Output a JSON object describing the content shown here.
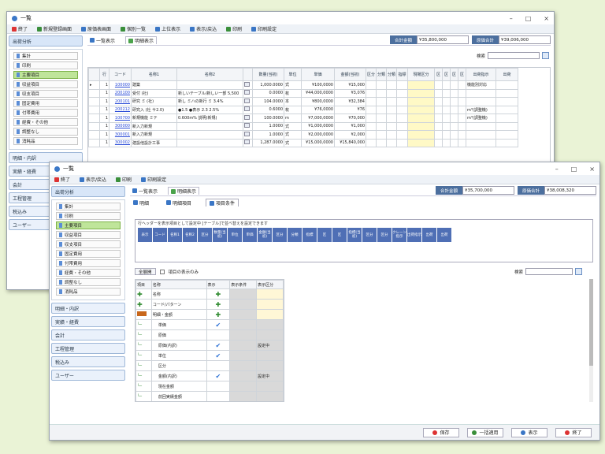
{
  "back": {
    "title": "一覧",
    "menu": [
      "終了",
      "新規登録画面",
      "原価表画面",
      "個別一覧",
      "上位表示",
      "表示/戻込",
      "印刷",
      "印刷設定"
    ],
    "tabs": [
      "一覧表示",
      "明細表示"
    ],
    "summary": [
      {
        "label": "合計金額",
        "value": "¥35,800,000"
      },
      {
        "label": "原価合計",
        "value": "¥39,006,000"
      }
    ],
    "search_label": "検索",
    "sidebar": {
      "sections": [
        "出荷分析",
        "明細・内訳",
        "実績・経費",
        "会計",
        "工程管理",
        "税込み",
        "ユーザー"
      ],
      "items": [
        "集計",
        "印刷",
        "主要項目",
        "収益項目",
        "収支項目",
        "固定費用",
        "付帯費用",
        "経費・その他",
        "調整なし",
        "消耗品"
      ]
    },
    "columns": [
      "行",
      "コード",
      "名称1",
      "名称2",
      "",
      "数量(当初)",
      "単位",
      "単価",
      "金額(当初)",
      "区分",
      "分類",
      "分類",
      "指標",
      "現場区分",
      "区",
      "区",
      "区",
      "区",
      "出荷指示",
      "出荷"
    ],
    "rows": [
      {
        "no": "1",
        "code": "100000",
        "n1": "建築",
        "n2": "",
        "qty": "1,000.0000",
        "unit": "式",
        "price": "¥100,0000",
        "amt": "¥15,000",
        "x1": "",
        "memo": "機能別対応"
      },
      {
        "no": "1",
        "code": "200100",
        "n1": "受付 (社)",
        "n2": "新しいテーブル/新しい一部 5,500",
        "qty": "0.0000",
        "unit": "枚",
        "price": "¥44,000,0000",
        "amt": "¥3,076",
        "x1": "",
        "memo": ""
      },
      {
        "no": "1",
        "code": "200101",
        "n1": "研究 ミ (社)",
        "n2": "新し ミハの新行 ミ 3.4%",
        "qty": "104.0000",
        "unit": "本",
        "price": "¥800,0000",
        "amt": "¥32,384",
        "x1": "",
        "memo": ""
      },
      {
        "no": "1",
        "code": "200212",
        "n1": "研究入 (社 サ2.0)",
        "n2": "●1.5 ●表示 2.3 2.5%",
        "qty": "0.6000",
        "unit": "枚",
        "price": "¥76,0000",
        "amt": "¥76",
        "x1": "",
        "memo": "m³(調整機)"
      },
      {
        "no": "1",
        "code": "100700",
        "n1": "新規機能 ミテ",
        "n2": "0.600m% 説明(新規)",
        "qty": "100.0000",
        "unit": "m",
        "price": "¥7,000,0000",
        "amt": "¥70,000",
        "x1": "",
        "memo": "m³(調整機)"
      },
      {
        "no": "1",
        "code": "300000",
        "n1": "新入力新規",
        "n2": "",
        "qty": "1.0000",
        "unit": "式",
        "price": "¥1,000,0000",
        "amt": "¥1,000",
        "x1": "",
        "memo": ""
      },
      {
        "no": "1",
        "code": "300001",
        "n1": "新入力新規",
        "n2": "",
        "qty": "1.0000",
        "unit": "式",
        "price": "¥2,000,0000",
        "amt": "¥2,000",
        "x1": "",
        "memo": ""
      },
      {
        "no": "1",
        "code": "300002",
        "n1": "建設他設計工事",
        "n2": "",
        "qty": "1,287.0000",
        "unit": "式",
        "price": "¥15,000,0000",
        "amt": "¥15,840,000",
        "x1": "",
        "memo": ""
      }
    ]
  },
  "front": {
    "title": "一覧",
    "menu": [
      "終了",
      "表示/戻込",
      "印刷",
      "印刷設定"
    ],
    "tabs": [
      "一覧表示",
      "明細表示"
    ],
    "subtabs": [
      "明細",
      "明細項目",
      "項目条件"
    ],
    "summary": [
      {
        "label": "合計金額",
        "value": "¥35,700,000"
      },
      {
        "label": "原価合計",
        "value": "¥38,008,320"
      }
    ],
    "group_label": "行ヘッダーを表示項目として設定中 [テーブル]で並べ替えを設定できます",
    "chips": [
      "表示",
      "コード",
      "名称1",
      "名称2",
      "区分",
      "数量(当初)",
      "単位",
      "単価",
      "金額(当初)",
      "区分",
      "分類",
      "指標",
      "区",
      "区",
      "指標(当初)",
      "区分",
      "区分",
      "クレーン指示",
      "出荷指示",
      "出荷",
      "出荷"
    ],
    "tree_btn": "全展開",
    "tree_check": "項目の表示のみ",
    "search_label": "検索",
    "tree_headers": [
      "項目",
      "名称",
      "表示",
      "表示条件",
      "表示区分"
    ],
    "tree_rows": [
      {
        "type": "plus",
        "name": "名称",
        "show": "plus",
        "cond": "",
        "flag": ""
      },
      {
        "type": "plus",
        "name": "コード/パターン",
        "show": "plus",
        "cond": "",
        "flag": ""
      },
      {
        "type": "minus",
        "name": "明細・金額",
        "show": "plus",
        "cond": "",
        "flag": ""
      },
      {
        "type": "child",
        "name": "単価",
        "show": "chk",
        "cond": "",
        "flag": ""
      },
      {
        "type": "child",
        "name": "原価",
        "show": "",
        "cond": "",
        "flag": ""
      },
      {
        "type": "child",
        "name": "原価(内訳)",
        "show": "chk",
        "cond": "",
        "flag": "設定中"
      },
      {
        "type": "child",
        "name": "単位",
        "show": "chk",
        "cond": "",
        "flag": ""
      },
      {
        "type": "child",
        "name": "区分",
        "show": "",
        "cond": "",
        "flag": ""
      },
      {
        "type": "child",
        "name": "金額(内訳)",
        "show": "chk",
        "cond": "",
        "flag": "設定中"
      },
      {
        "type": "child",
        "name": "現在金額",
        "show": "",
        "cond": "",
        "flag": ""
      },
      {
        "type": "child",
        "name": "前回実績金額",
        "show": "",
        "cond": "",
        "flag": ""
      },
      {
        "type": "child",
        "name": "前回実績金額",
        "show": "",
        "cond": "",
        "flag": ""
      },
      {
        "type": "plus",
        "name": "数量項目",
        "show": "plus",
        "cond": "",
        "flag": ""
      },
      {
        "type": "plus",
        "name": "記号/名称",
        "show": "plus",
        "cond": "",
        "flag": ""
      }
    ],
    "sidebar": {
      "sections": [
        "出荷分析",
        "明細・内訳",
        "実績・経費",
        "会計",
        "工程管理",
        "税込み",
        "ユーザー"
      ],
      "items": [
        "集計",
        "印刷",
        "主要項目",
        "収益項目",
        "収支項目",
        "固定費用",
        "付帯費用",
        "経費・その他",
        "調整なし",
        "消耗品"
      ]
    },
    "footer": [
      "保存",
      "一括適用",
      "表示",
      "終了"
    ]
  },
  "colors": {
    "accent": "#4c6f9e",
    "selected": "#bfe59a",
    "background": "#eaf3d6"
  }
}
